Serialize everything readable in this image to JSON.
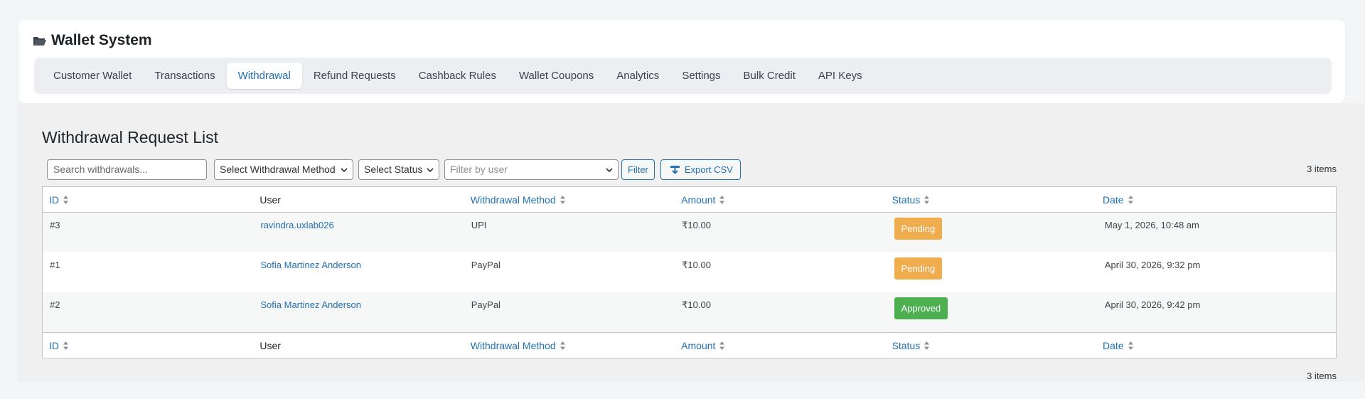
{
  "app": {
    "title": "Wallet System",
    "icon": "folder-open-icon"
  },
  "tabs": [
    {
      "label": "Customer Wallet",
      "active": false
    },
    {
      "label": "Transactions",
      "active": false
    },
    {
      "label": "Withdrawal",
      "active": true
    },
    {
      "label": "Refund Requests",
      "active": false
    },
    {
      "label": "Cashback Rules",
      "active": false
    },
    {
      "label": "Wallet Coupons",
      "active": false
    },
    {
      "label": "Analytics",
      "active": false
    },
    {
      "label": "Settings",
      "active": false
    },
    {
      "label": "Bulk Credit",
      "active": false
    },
    {
      "label": "API Keys",
      "active": false
    }
  ],
  "page": {
    "heading": "Withdrawal Request List"
  },
  "filters": {
    "search_placeholder": "Search withdrawals...",
    "method_select": "Select Withdrawal Method",
    "status_select": "Select Status",
    "user_filter_placeholder": "Filter by user",
    "filter_button": "Filter",
    "export_button": "Export CSV"
  },
  "items_count": "3 items",
  "table": {
    "columns": [
      "ID",
      "User",
      "Withdrawal Method",
      "Amount",
      "Status",
      "Date"
    ],
    "rows": [
      {
        "id": "#3",
        "user": "ravindra.uxlab026",
        "method": "UPI",
        "amount": "₹10.00",
        "status": "Pending",
        "date": "May 1, 2026, 10:48 am"
      },
      {
        "id": "#1",
        "user": "Sofia Martinez Anderson",
        "method": "PayPal",
        "amount": "₹10.00",
        "status": "Pending",
        "date": "April 30, 2026, 9:32 pm"
      },
      {
        "id": "#2",
        "user": "Sofia Martinez Anderson",
        "method": "PayPal",
        "amount": "₹10.00",
        "status": "Approved",
        "date": "April 30, 2026, 9:42 pm"
      }
    ]
  },
  "colors": {
    "accent": "#2271b1",
    "pending": "#f0ad4e",
    "approved": "#4caf50"
  }
}
